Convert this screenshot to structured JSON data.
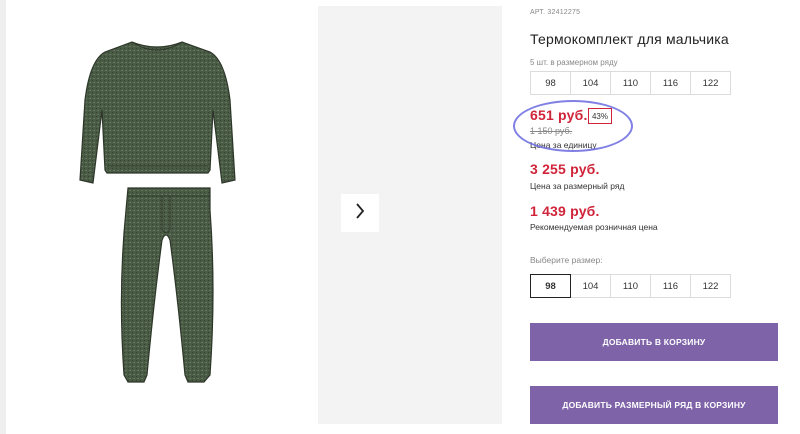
{
  "product": {
    "article": "АРТ. 32412275",
    "title": "Термокомплект для мальчика"
  },
  "size_row": {
    "caption": "5 шт. в размерном ряду",
    "sizes": [
      "98",
      "104",
      "110",
      "116",
      "122"
    ]
  },
  "prices": {
    "unit_price": "651 руб.",
    "discount_badge": "43%",
    "old_price": "1 150 руб.",
    "unit_caption": "Цена за единицу",
    "row_price": "3 255 руб.",
    "row_caption": "Цена за размерный ряд",
    "retail_price": "1 439 руб.",
    "retail_caption": "Рекомендуемая розничная цена"
  },
  "size_select": {
    "label": "Выберите размер:",
    "sizes": [
      "98",
      "104",
      "110",
      "116",
      "122"
    ],
    "selected": "98"
  },
  "actions": {
    "add_to_cart": "ДОБАВИТЬ В КОРЗИНУ",
    "add_row_to_cart": "ДОБАВИТЬ РАЗМЕРНЫЙ РЯД В КОРЗИНУ"
  },
  "colors": {
    "price_red": "#d0243a",
    "button_purple": "#7e63a8",
    "garment_green": "#4a5b45",
    "highlight_ring": "#6b6be0"
  }
}
